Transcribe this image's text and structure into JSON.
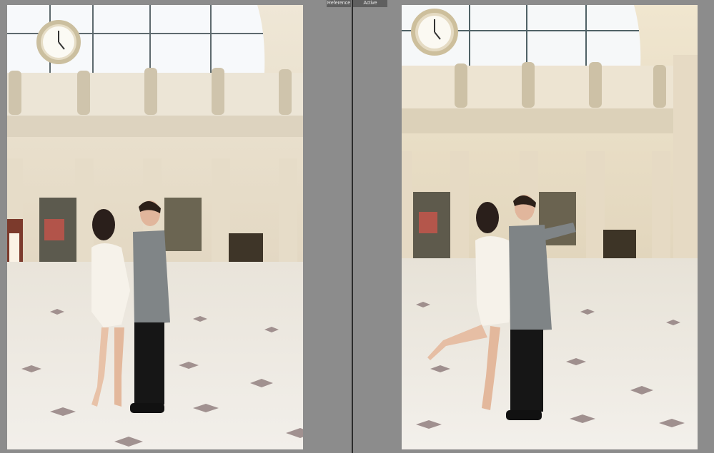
{
  "compare_view": {
    "reference_label": "Reference",
    "active_label": "Active"
  },
  "colors": {
    "panel_background": "#8c8c8c",
    "divider": "#2b2b2b",
    "tab_background": "#5f5f5f",
    "tab_text": "#e8e8e8"
  },
  "photos": {
    "reference": {
      "description": "couple embracing in station hall, reference photo"
    },
    "active": {
      "description": "couple embracing in station hall, woman lifting leg, active photo"
    }
  }
}
